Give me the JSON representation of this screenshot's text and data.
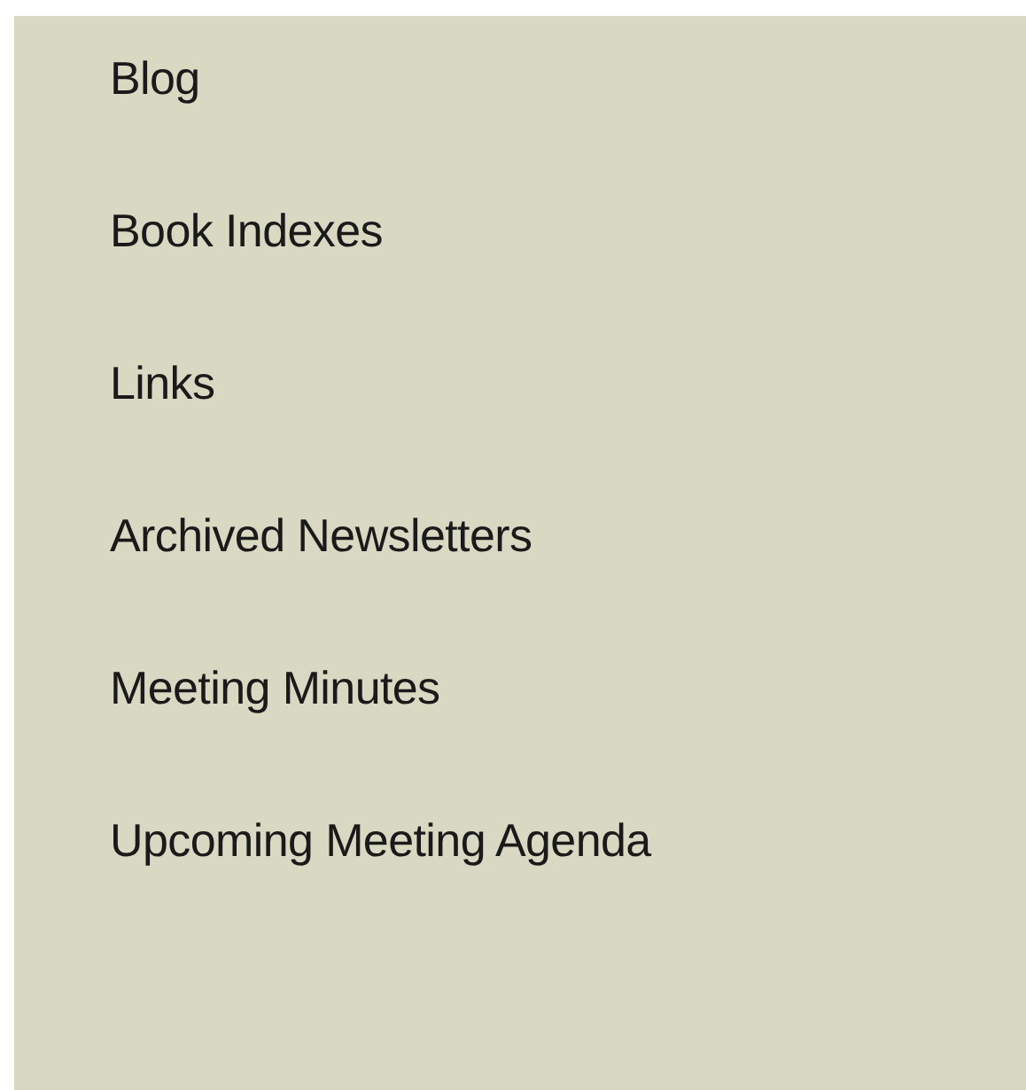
{
  "menu": {
    "items": [
      {
        "label": "Blog"
      },
      {
        "label": "Book Indexes"
      },
      {
        "label": "Links"
      },
      {
        "label": "Archived Newsletters"
      },
      {
        "label": "Meeting Minutes"
      },
      {
        "label": "Upcoming Meeting Agenda"
      }
    ]
  }
}
